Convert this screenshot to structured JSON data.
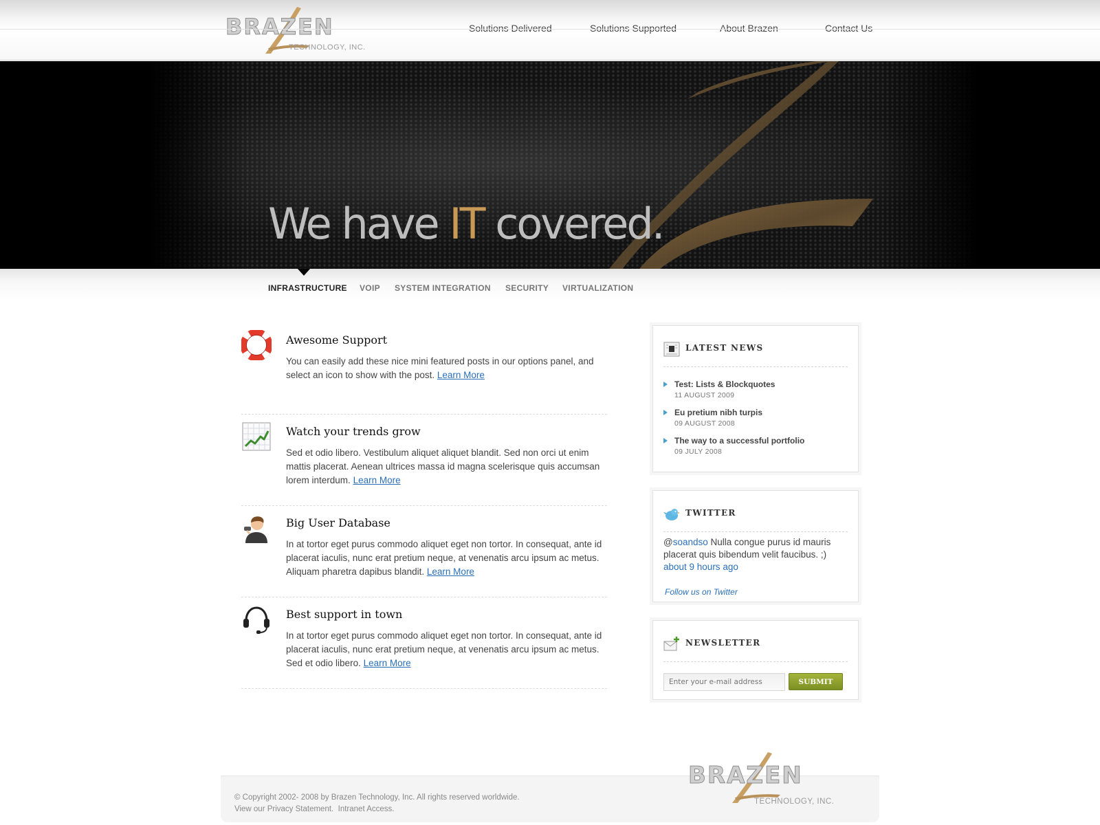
{
  "brand": {
    "name": "BRAZEN",
    "subtitle": "TECHNOLOGY, INC.",
    "accent_color": "#c99a55"
  },
  "topnav": {
    "items": [
      {
        "label": "Solutions Delivered"
      },
      {
        "label": "Solutions Supported"
      },
      {
        "label": "About Brazen"
      },
      {
        "label": "Contact Us"
      }
    ]
  },
  "hero": {
    "title_pre": "We have ",
    "title_highlight": "IT",
    "title_post": " covered."
  },
  "subnav": {
    "items": [
      {
        "label": "INFRASTRUCTURE",
        "active": true
      },
      {
        "label": "VOIP"
      },
      {
        "label": "SYSTEM INTEGRATION"
      },
      {
        "label": "SECURITY"
      },
      {
        "label": "VIRTUALIZATION"
      }
    ]
  },
  "features": [
    {
      "icon": "lifebuoy-icon",
      "title": "Awesome Support",
      "text": "You can easily add these nice mini featured posts in our options panel, and select an icon to show with the post.",
      "link": "Learn More"
    },
    {
      "icon": "trend-chart-icon",
      "title": "Watch your trends grow",
      "text": "Sed et odio libero. Vestibulum aliquet aliquet blandit. Sed non orci ut enim mattis placerat. Aenean ultrices massa id magna scelerisque quis accumsan lorem interdum.",
      "link": "Learn More"
    },
    {
      "icon": "user-icon",
      "title": "Big User Database",
      "text": "In at tortor eget purus commodo aliquet eget non tortor. In consequat, ante id placerat iaculis, nunc erat pretium neque, at venenatis arcu ipsum ac metus. Aliquam pharetra dapibus blandit.",
      "link": "Learn More"
    },
    {
      "icon": "headset-icon",
      "title": "Best support in town",
      "text": "In at tortor eget purus commodo aliquet eget non tortor. In consequat, ante id placerat iaculis, nunc erat pretium neque, at venenatis arcu ipsum ac metus. Sed et odio libero.",
      "link": "Learn More"
    }
  ],
  "sidebar": {
    "news": {
      "title": "LATEST NEWS",
      "icon": "newspaper-icon",
      "items": [
        {
          "title": "Test: Lists & Blockquotes",
          "date": "11 AUGUST 2009"
        },
        {
          "title": "Eu pretium nibh turpis",
          "date": "09 AUGUST 2008"
        },
        {
          "title": "The way to a successful portfolio",
          "date": "09 JULY 2008"
        }
      ]
    },
    "twitter": {
      "title": "TWITTER",
      "icon": "bird-icon",
      "at": "@",
      "handle": "soandso",
      "text": " Nulla congue purus id mauris placerat quis bibendum velit faucibus. ;)",
      "time": "about 9 hours ago",
      "follow": "Follow us on Twitter"
    },
    "newsletter": {
      "title": "NEWSLETTER",
      "icon": "envelope-add-icon",
      "placeholder": "Enter your e-mail address",
      "submit": "SUBMIT"
    }
  },
  "footer": {
    "copyright": "© Copyright 2002- 2008 by Brazen Technology, Inc. All rights reserved worldwide.",
    "line2_prefix": "View our ",
    "privacy": "Privacy Statement.",
    "intranet": "Intranet Access."
  }
}
